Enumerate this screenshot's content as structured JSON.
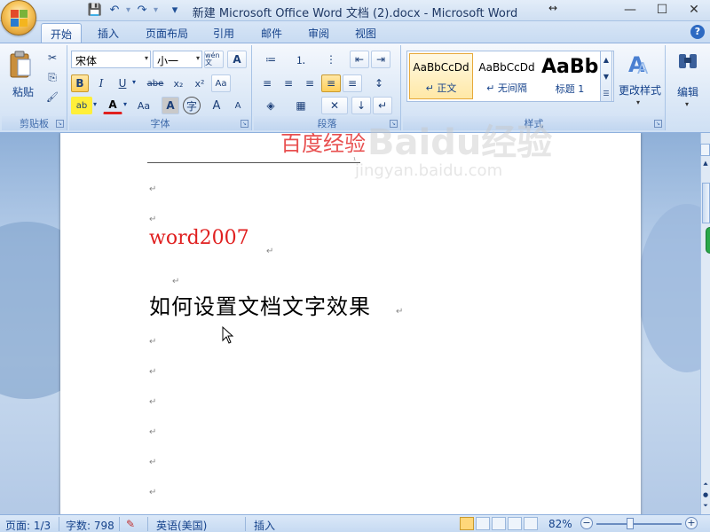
{
  "window": {
    "title": "新建 Microsoft Office Word 文档 (2).docx - Microsoft Word",
    "minimize": "—",
    "maximize": "☐",
    "close": "✕",
    "resize_glyph": "↔"
  },
  "quick_access": {
    "save": "💾",
    "undo": "↶",
    "redo": "↷",
    "more": "▾"
  },
  "tabs": [
    {
      "label": "开始",
      "active": true
    },
    {
      "label": "插入"
    },
    {
      "label": "页面布局"
    },
    {
      "label": "引用"
    },
    {
      "label": "邮件"
    },
    {
      "label": "审阅"
    },
    {
      "label": "视图"
    }
  ],
  "help": "?",
  "ribbon": {
    "clipboard": {
      "label": "剪贴板",
      "paste_label": "粘贴",
      "cut": "✂",
      "copy": "⎘",
      "format_painter": "🖌"
    },
    "font": {
      "label": "字体",
      "font_name": "宋体",
      "font_size": "小一",
      "phonetic": "wén文",
      "char_border": "A",
      "bold": "B",
      "italic": "I",
      "underline": "U",
      "strike": "abe",
      "subscript": "x₂",
      "superscript": "x²",
      "clear": "Aa",
      "highlight": "ab",
      "font_color": "A",
      "change_case": "Aa",
      "char_shading": "A",
      "enclose": "字",
      "grow": "A",
      "shrink": "A"
    },
    "paragraph": {
      "label": "段落",
      "bullets": "≔",
      "numbering": "⒈",
      "multilevel": "⋮",
      "decrease_indent": "⇤",
      "increase_indent": "⇥",
      "align_left": "≡",
      "align_center": "≡",
      "align_right": "≡",
      "justify": "≡",
      "distributed": "≡",
      "line_spacing": "↕",
      "shading": "◈",
      "borders": "▦",
      "chinese_layout": "✕",
      "sort": "↓",
      "show_marks": "↵"
    },
    "styles": {
      "label": "样式",
      "items": [
        {
          "sample": "AaBbCcDd",
          "name": "↵ 正文"
        },
        {
          "sample": "AaBbCcDd",
          "name": "↵ 无间隔"
        },
        {
          "sample": "AaBb",
          "name": "标题 1"
        }
      ],
      "change_styles": "更改样式"
    },
    "editing": {
      "label": "编辑"
    }
  },
  "document": {
    "header_text": "百度经验",
    "line1": "word2007",
    "line2": "如何设置文档文字效果",
    "para_mark": "↵"
  },
  "watermark": {
    "brand": "Baidu经验",
    "url": "jingyan.baidu.com"
  },
  "statusbar": {
    "page": "页面: 1/3",
    "words": "字数: 798",
    "language": "英语(美国)",
    "mode": "插入",
    "zoom": "82%",
    "zoom_out": "−",
    "zoom_in": "+"
  },
  "colors": {
    "accent_red": "#e02020",
    "ribbon_text": "#15428b",
    "selected_style": "#ffe8a6"
  }
}
